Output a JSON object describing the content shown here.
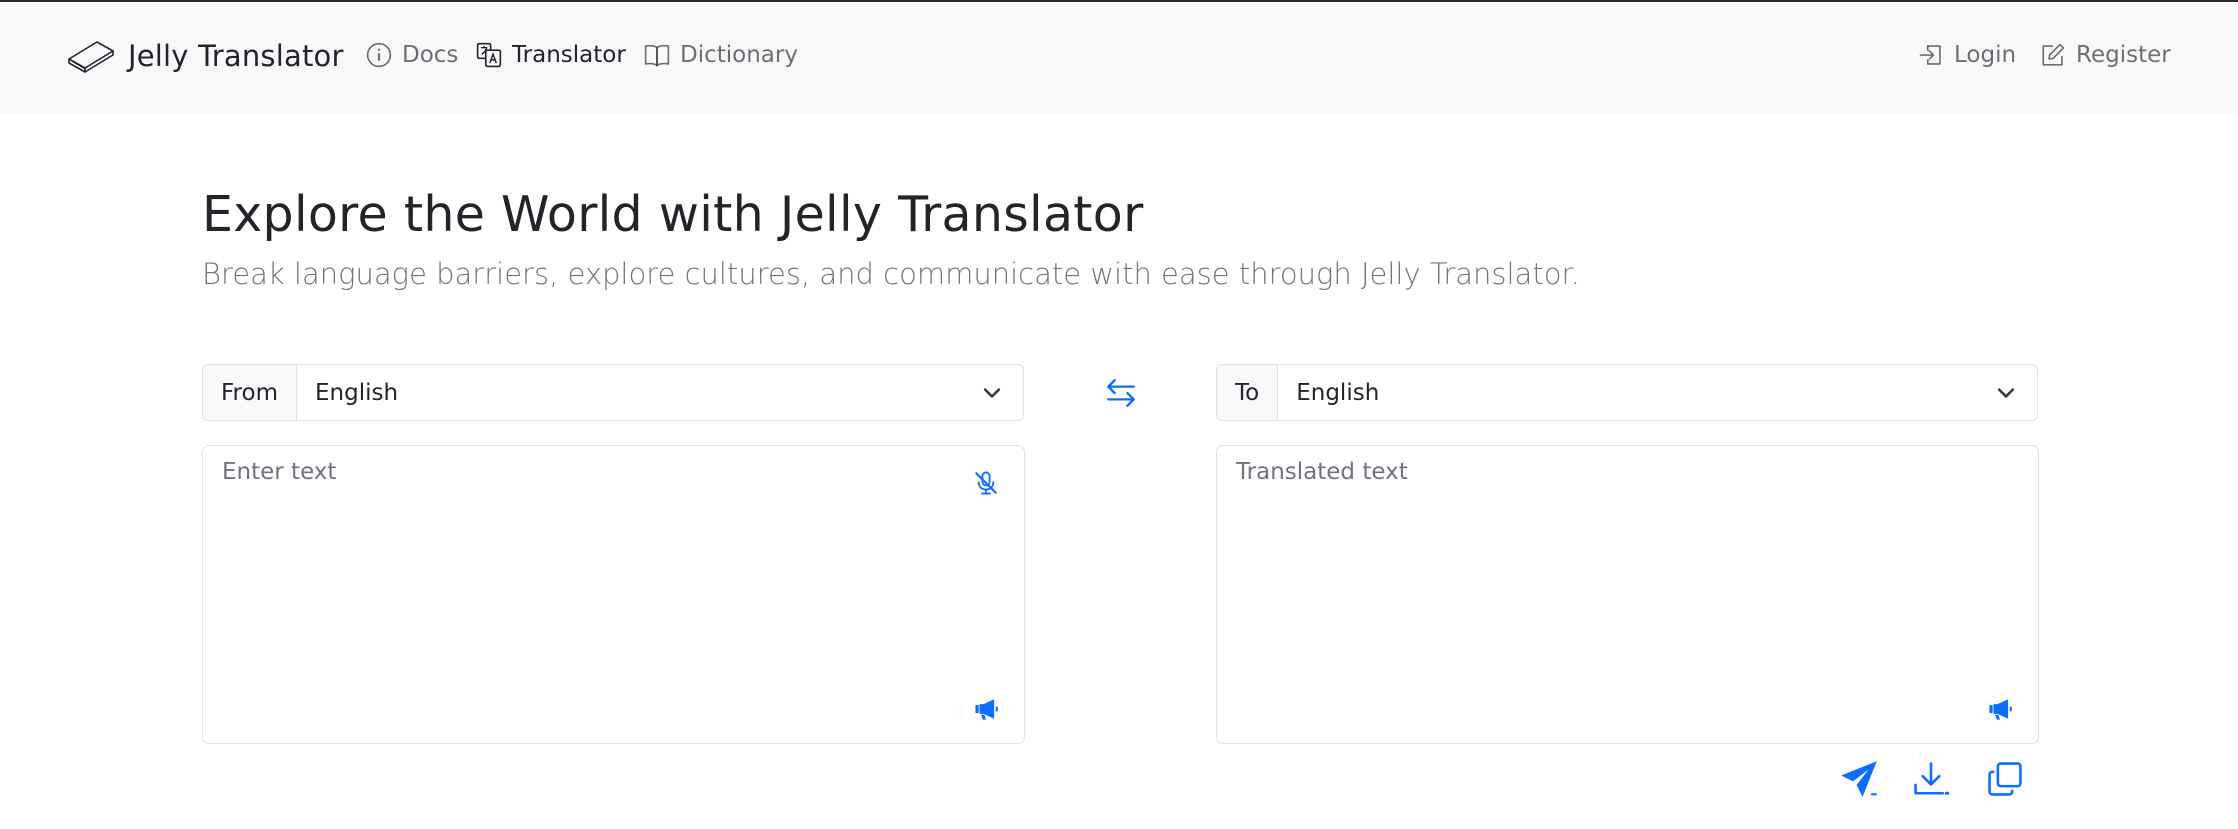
{
  "navbar": {
    "brand": {
      "name": "Jelly Translator",
      "icon": "book-icon"
    },
    "links": [
      {
        "label": "Docs",
        "icon": "info-circle-icon",
        "active": false
      },
      {
        "label": "Translator",
        "icon": "translate-icon",
        "active": true
      },
      {
        "label": "Dictionary",
        "icon": "book-open-icon",
        "active": false
      }
    ],
    "auth": [
      {
        "label": "Login",
        "icon": "login-arrow-icon"
      },
      {
        "label": "Register",
        "icon": "pencil-square-icon"
      }
    ]
  },
  "hero": {
    "title": "Explore the World with Jelly Translator",
    "subtitle": "Break language barriers, explore cultures, and communicate with ease through Jelly Translator."
  },
  "source": {
    "label": "From",
    "language": "English",
    "placeholder": "Enter text",
    "value": ""
  },
  "target": {
    "label": "To",
    "language": "English",
    "placeholder": "Translated text",
    "value": ""
  },
  "icons": {
    "swap": "swap-arrows-icon",
    "mic": "mic-mute-icon",
    "speak": "megaphone-icon",
    "send": "send-icon",
    "download": "download-icon",
    "copy": "copy-icon"
  },
  "colors": {
    "accent": "#0d6efd",
    "navbar_bg": "#f8f9fa",
    "text": "#212529",
    "muted": "#6c757d",
    "border": "#dee2e6"
  }
}
